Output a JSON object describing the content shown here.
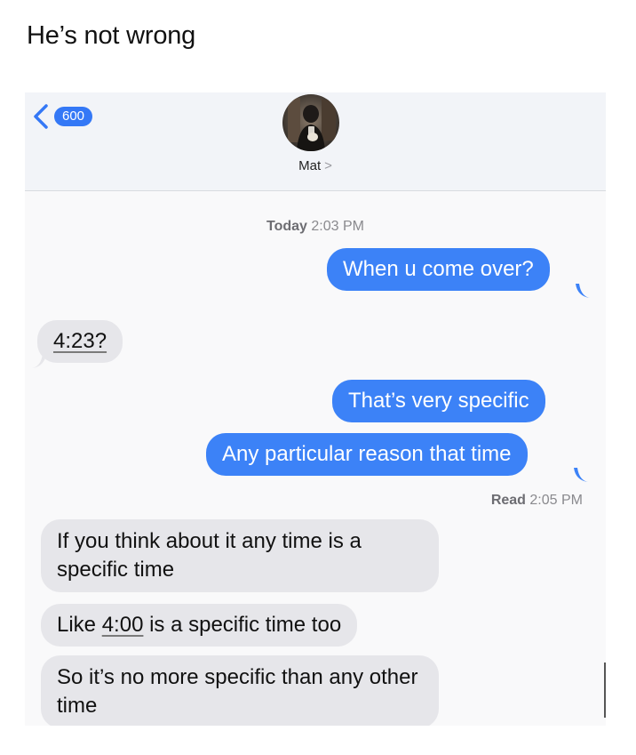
{
  "post": {
    "title": "He’s not wrong"
  },
  "header": {
    "back_badge": "600",
    "contact_name": "Mat",
    "contact_chevron": ">",
    "avatar_icon": "avatar-photo"
  },
  "thread": {
    "timestamp_day": "Today",
    "timestamp_time": "2:03 PM",
    "messages": [
      {
        "side": "out",
        "text": "When u come over?"
      },
      {
        "side": "in",
        "text": "4:23?"
      },
      {
        "side": "out",
        "text": "That’s very specific"
      },
      {
        "side": "out",
        "text": "Any particular reason that time"
      },
      {
        "side": "in",
        "text": "If you think about it any time is a specific time"
      },
      {
        "side": "in",
        "text_before": "Like ",
        "text_link": "4:00",
        "text_after": " is a specific time too"
      },
      {
        "side": "in",
        "text": "So it’s no more specific than any other time"
      }
    ],
    "read_label": "Read",
    "read_time": "2:05 PM"
  },
  "colors": {
    "outgoing_bubble": "#3c82f7",
    "incoming_bubble": "#e6e6ea",
    "badge": "#3478f6"
  }
}
